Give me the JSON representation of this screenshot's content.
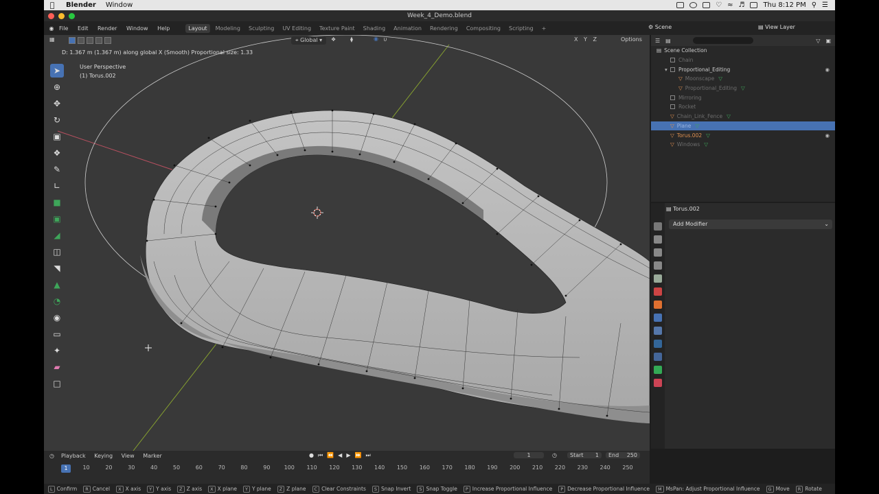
{
  "macmenu": {
    "app": "Blender",
    "window": "Window",
    "clock": "Thu 8:12 PM"
  },
  "titlebar": {
    "filename": "Week_4_Demo.blend"
  },
  "topbar": {
    "menus": [
      "File",
      "Edit",
      "Render",
      "Window",
      "Help"
    ],
    "workspaces": [
      "Layout",
      "Modeling",
      "Sculpting",
      "UV Editing",
      "Texture Paint",
      "Shading",
      "Animation",
      "Rendering",
      "Compositing",
      "Scripting"
    ],
    "active_workspace": "Layout",
    "add_workspace": "+",
    "scene": "Scene",
    "view_layer": "View Layer"
  },
  "viewport": {
    "transform_orientation": "Global",
    "axes": "X Y Z",
    "options": "Options",
    "status": "D: 1.367 m (1.367 m) along global X (Smooth)   Proportional size: 1.33",
    "perspective": "User Perspective",
    "object": "(1) Torus.002",
    "accent": "#4772b3"
  },
  "outliner": {
    "collection": "Scene Collection",
    "rows": [
      {
        "label": "Chain",
        "dim": true,
        "indent": 1
      },
      {
        "label": "Proportional_Editing",
        "dim": false,
        "indent": 1,
        "expanded": true
      },
      {
        "label": "Moonscape",
        "dim": true,
        "indent": 2,
        "obj": true,
        "mod": true
      },
      {
        "label": "Proportional_Editing",
        "dim": true,
        "indent": 2,
        "obj": true,
        "mod": true
      },
      {
        "label": "Mirroring",
        "dim": true,
        "indent": 1
      },
      {
        "label": "Rocket",
        "dim": true,
        "indent": 1
      },
      {
        "label": "Chain_Link_Fence",
        "dim": true,
        "indent": 1,
        "obj": true,
        "mod": true
      },
      {
        "label": "Plane",
        "dim": true,
        "indent": 1,
        "obj": true,
        "sel": true,
        "mod": true
      },
      {
        "label": "Torus.002",
        "dim": false,
        "indent": 1,
        "obj": true,
        "mod": true,
        "active": true
      },
      {
        "label": "Windows",
        "dim": true,
        "indent": 1,
        "obj": true,
        "mod": true
      }
    ]
  },
  "properties": {
    "object": "Torus.002",
    "add_modifier": "Add Modifier"
  },
  "timeline": {
    "menus": [
      "Playback",
      "Keying",
      "View",
      "Marker"
    ],
    "current_frame": "1",
    "start_label": "Start",
    "start": "1",
    "end_label": "End",
    "end": "250",
    "ticks": [
      "1",
      "10",
      "20",
      "30",
      "40",
      "50",
      "60",
      "70",
      "80",
      "90",
      "100",
      "110",
      "120",
      "130",
      "140",
      "150",
      "160",
      "170",
      "180",
      "190",
      "200",
      "210",
      "220",
      "230",
      "240",
      "250"
    ]
  },
  "statusbar": {
    "items": [
      {
        "key": "L",
        "label": "Confirm"
      },
      {
        "key": "R",
        "label": "Cancel"
      },
      {
        "key": "X",
        "label": "X axis"
      },
      {
        "key": "Y",
        "label": "Y axis"
      },
      {
        "key": "Z",
        "label": "Z axis"
      },
      {
        "key": "X",
        "label": "X plane"
      },
      {
        "key": "Y",
        "label": "Y plane"
      },
      {
        "key": "Z",
        "label": "Z plane"
      },
      {
        "key": "C",
        "label": "Clear Constraints"
      },
      {
        "key": "S",
        "label": "Snap Invert"
      },
      {
        "key": "S",
        "label": "Snap Toggle"
      },
      {
        "key": "P",
        "label": "Increase Proportional Influence"
      },
      {
        "key": "P",
        "label": "Decrease Proportional Influence"
      },
      {
        "key": "M",
        "label": "MsPan: Adjust Proportional Influence"
      },
      {
        "key": "G",
        "label": "Move"
      },
      {
        "key": "R",
        "label": "Rotate"
      }
    ]
  }
}
